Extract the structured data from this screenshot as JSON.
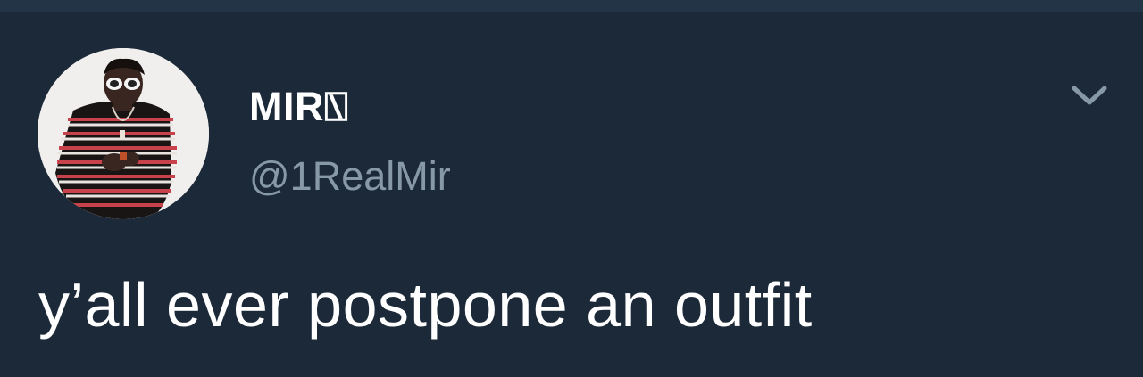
{
  "theme": {
    "background": "#1c2938",
    "top_bar": "#243447",
    "name_color": "#ffffff",
    "handle_color": "#8899a6",
    "text_color": "#ffffff"
  },
  "tweet": {
    "author": {
      "display_name": "MIR⍂",
      "handle": "@1RealMir",
      "avatar_icon": "user-avatar-photo"
    },
    "menu_icon": "chevron-down-icon",
    "text": "y’all ever postpone an outfit"
  }
}
